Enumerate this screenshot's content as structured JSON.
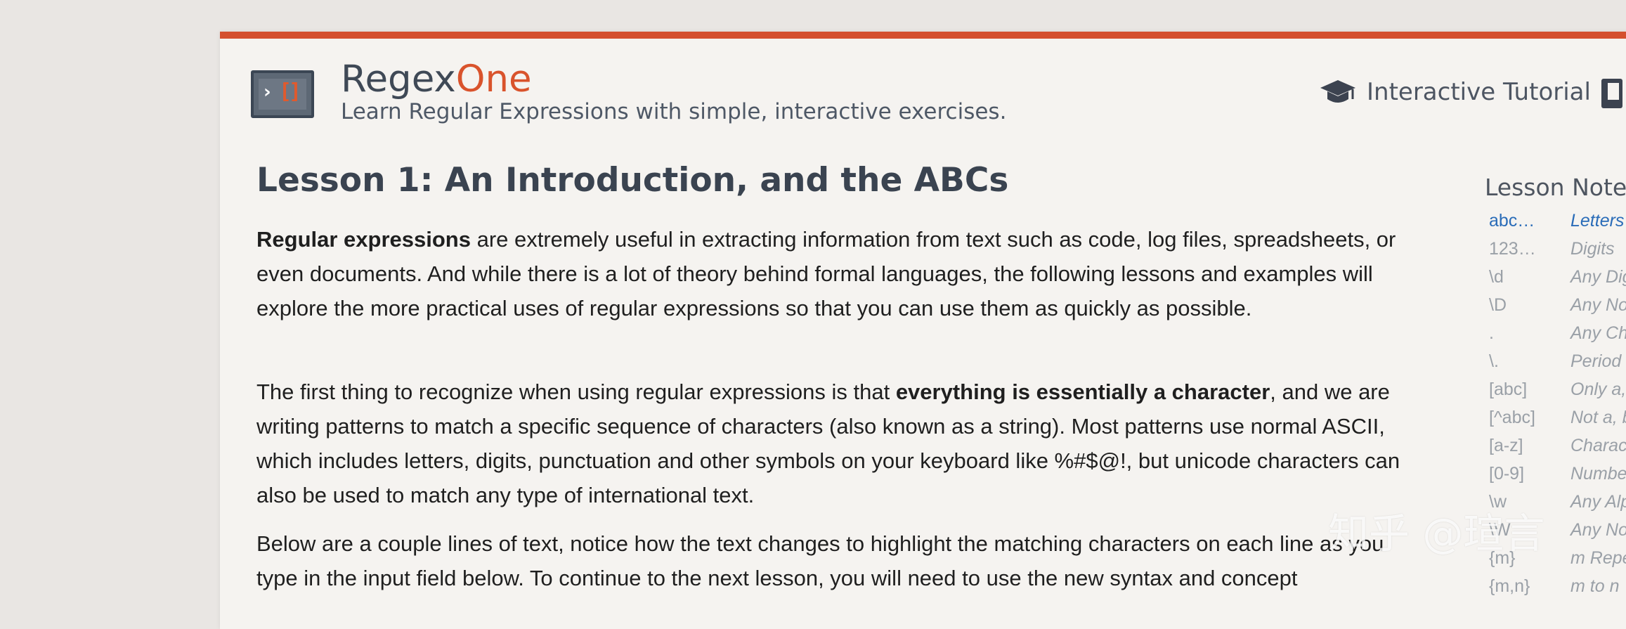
{
  "header": {
    "brand_primary": "Regex",
    "brand_accent": "One",
    "tagline": "Learn Regular Expressions with simple, interactive exercises.",
    "nav_interactive": "Interactive Tutorial"
  },
  "lesson": {
    "title": "Lesson 1: An Introduction, and the ABCs",
    "p1_bold": "Regular expressions",
    "p1_text": " are extremely useful in extracting information from text such as code, log files, spreadsheets, or even documents. And while there is a lot of theory behind formal languages, the following lessons and examples will explore the more practical uses of regular expressions so that you can use them as quickly as possible.",
    "p2_text_a": "The first thing to recognize when using regular expressions is that ",
    "p2_bold": "everything is essentially a character",
    "p2_text_b": ", and we are writing patterns to match a specific sequence of characters (also known as a string). Most patterns use normal ASCII, which includes letters, digits, punctuation and other symbols on your keyboard like %#$@!, but unicode characters can also be used to match any type of international text.",
    "p3_text": "Below are a couple lines of text, notice how the text changes to highlight the matching characters on each line as you type in the input field below. To continue to the next lesson, you will need to use the new syntax and concept"
  },
  "notes": {
    "title": "Lesson Notes",
    "items": [
      {
        "symbol": "abc…",
        "desc": "Letters"
      },
      {
        "symbol": "123…",
        "desc": "Digits"
      },
      {
        "symbol": "\\d",
        "desc": "Any Dig"
      },
      {
        "symbol": "\\D",
        "desc": "Any No"
      },
      {
        "symbol": ".",
        "desc": "Any Ch"
      },
      {
        "symbol": "\\.",
        "desc": "Period"
      },
      {
        "symbol": "[abc]",
        "desc": "Only a,"
      },
      {
        "symbol": "[^abc]",
        "desc": "Not a, b"
      },
      {
        "symbol": "[a-z]",
        "desc": "Charac"
      },
      {
        "symbol": "[0-9]",
        "desc": "Numbe"
      },
      {
        "symbol": "\\w",
        "desc": "Any Alp"
      },
      {
        "symbol": "\\W",
        "desc": "Any No"
      },
      {
        "symbol": "{m}",
        "desc": "m Repe"
      },
      {
        "symbol": "{m,n}",
        "desc": "m to n"
      }
    ]
  },
  "watermark": "知乎 @瑄言",
  "colors": {
    "accent": "#d4502f",
    "page_bg": "#f5f3f0",
    "outer_bg": "#e9e6e3",
    "link_blue": "#2a6cb8",
    "notes_gray": "#9aa0a7"
  },
  "icons": {
    "logo": "regexone-logo-icon",
    "nav": "graduation-cap-icon",
    "book": "book-icon"
  }
}
